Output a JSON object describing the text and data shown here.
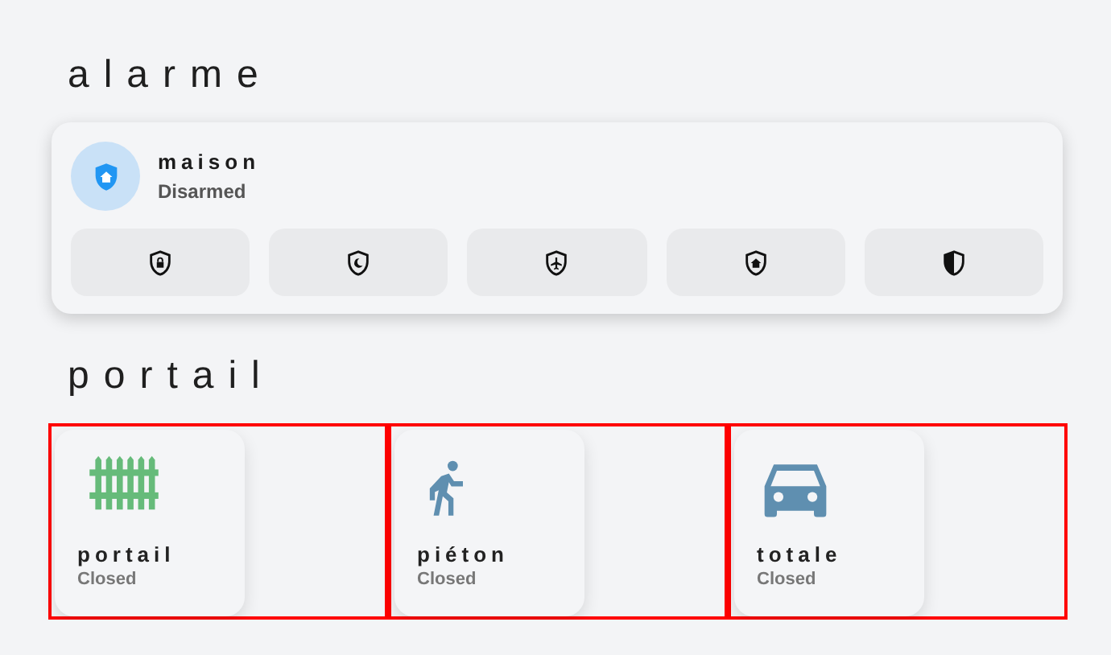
{
  "sections": [
    {
      "title": "alarme",
      "panel": {
        "name": "maison",
        "state": "Disarmed",
        "modes": [
          {
            "kind": "lock"
          },
          {
            "kind": "moon"
          },
          {
            "kind": "plane"
          },
          {
            "kind": "home"
          },
          {
            "kind": "half"
          }
        ]
      }
    },
    {
      "title": "portail",
      "tiles": [
        {
          "name": "portail",
          "state": "Closed",
          "kind": "fence",
          "color": "#66bb7a",
          "highlighted": true
        },
        {
          "name": "piéton",
          "state": "Closed",
          "kind": "walker",
          "color": "#5f8fb0",
          "highlighted": true
        },
        {
          "name": "totale",
          "state": "Closed",
          "kind": "car",
          "color": "#5f8fb0",
          "highlighted": true
        }
      ]
    }
  ]
}
